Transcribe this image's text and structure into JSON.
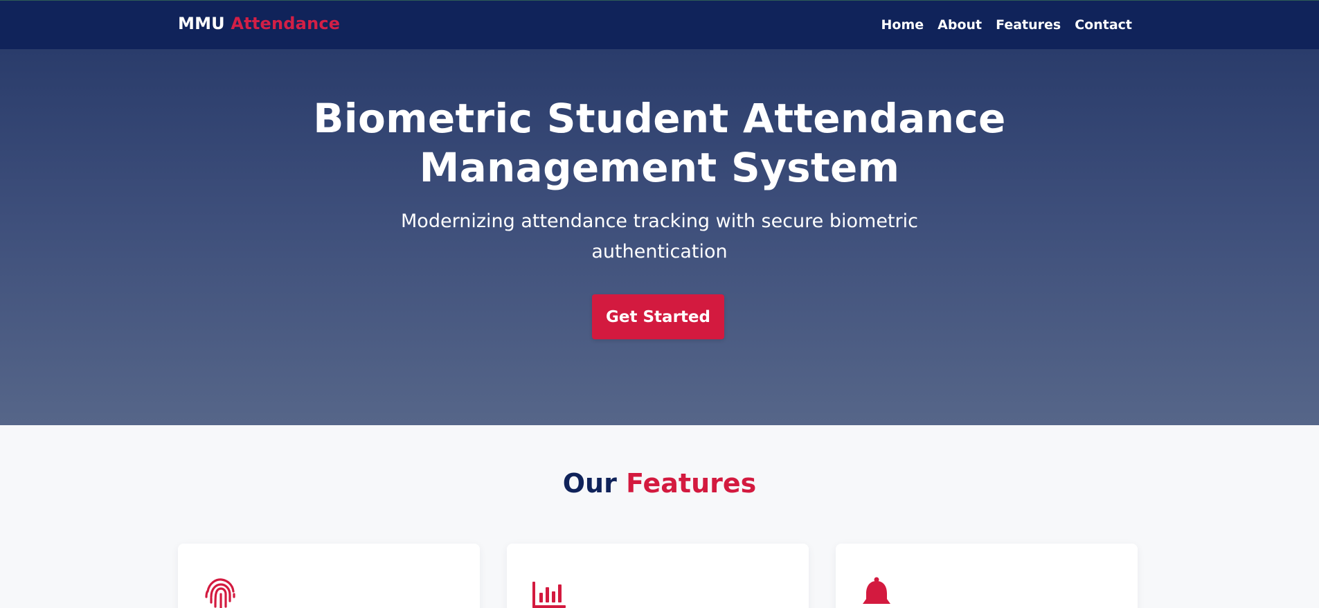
{
  "navbar": {
    "brand_primary": "MMU",
    "brand_accent": "Attendance",
    "links": [
      {
        "label": "Home"
      },
      {
        "label": "About"
      },
      {
        "label": "Features"
      },
      {
        "label": "Contact"
      }
    ]
  },
  "hero": {
    "title_line1": "Biometric Student Attendance",
    "title_line2": "Management System",
    "subtitle": "Modernizing attendance tracking with secure biometric authentication",
    "cta_label": "Get Started"
  },
  "features": {
    "title_primary": "Our",
    "title_accent": "Features",
    "cards": [
      {
        "icon": "fingerprint-icon"
      },
      {
        "icon": "bar-chart-icon"
      },
      {
        "icon": "bell-icon"
      }
    ]
  },
  "colors": {
    "navy": "#10235a",
    "accent": "#d31a3f",
    "hero_top": "#2a3c6b",
    "hero_bottom": "#566689",
    "section_bg": "#f7f8fa"
  }
}
